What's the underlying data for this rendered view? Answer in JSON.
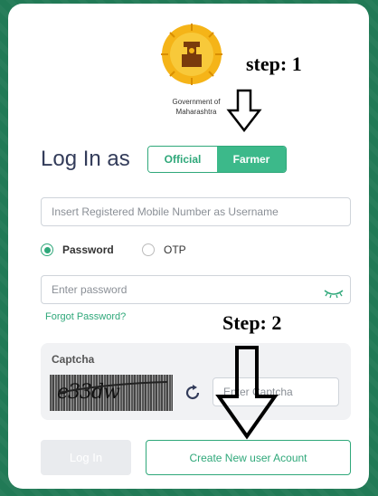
{
  "emblem": {
    "line1": "Government of",
    "line2": "Maharashtra"
  },
  "annotations": {
    "step1": "step: 1",
    "step2": "Step: 2"
  },
  "login": {
    "heading": "Log In as",
    "toggle": {
      "official": "Official",
      "farmer": "Farmer",
      "selected": "Farmer"
    },
    "username": {
      "placeholder": "Insert Registered Mobile Number as Username"
    },
    "auth_method": {
      "password_label": "Password",
      "otp_label": "OTP",
      "selected": "Password"
    },
    "password": {
      "placeholder": "Enter password"
    },
    "forgot": "Forgot Password?",
    "captcha": {
      "label": "Captcha",
      "image_text": "e33dw",
      "placeholder": "Enter Captcha"
    },
    "login_button": "Log In",
    "create_button": "Create New user Acount"
  },
  "colors": {
    "accent": "#2fa87a",
    "background": "#217a56",
    "heading": "#333c5a"
  }
}
